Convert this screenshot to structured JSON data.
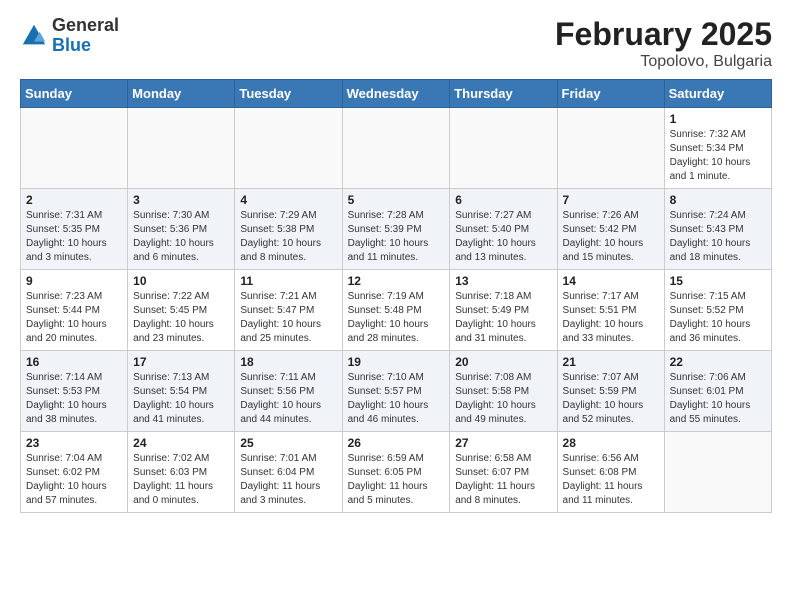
{
  "header": {
    "logo_general": "General",
    "logo_blue": "Blue",
    "month": "February 2025",
    "location": "Topolovo, Bulgaria"
  },
  "weekdays": [
    "Sunday",
    "Monday",
    "Tuesday",
    "Wednesday",
    "Thursday",
    "Friday",
    "Saturday"
  ],
  "weeks": [
    [
      {
        "day": "",
        "info": ""
      },
      {
        "day": "",
        "info": ""
      },
      {
        "day": "",
        "info": ""
      },
      {
        "day": "",
        "info": ""
      },
      {
        "day": "",
        "info": ""
      },
      {
        "day": "",
        "info": ""
      },
      {
        "day": "1",
        "info": "Sunrise: 7:32 AM\nSunset: 5:34 PM\nDaylight: 10 hours\nand 1 minute."
      }
    ],
    [
      {
        "day": "2",
        "info": "Sunrise: 7:31 AM\nSunset: 5:35 PM\nDaylight: 10 hours\nand 3 minutes."
      },
      {
        "day": "3",
        "info": "Sunrise: 7:30 AM\nSunset: 5:36 PM\nDaylight: 10 hours\nand 6 minutes."
      },
      {
        "day": "4",
        "info": "Sunrise: 7:29 AM\nSunset: 5:38 PM\nDaylight: 10 hours\nand 8 minutes."
      },
      {
        "day": "5",
        "info": "Sunrise: 7:28 AM\nSunset: 5:39 PM\nDaylight: 10 hours\nand 11 minutes."
      },
      {
        "day": "6",
        "info": "Sunrise: 7:27 AM\nSunset: 5:40 PM\nDaylight: 10 hours\nand 13 minutes."
      },
      {
        "day": "7",
        "info": "Sunrise: 7:26 AM\nSunset: 5:42 PM\nDaylight: 10 hours\nand 15 minutes."
      },
      {
        "day": "8",
        "info": "Sunrise: 7:24 AM\nSunset: 5:43 PM\nDaylight: 10 hours\nand 18 minutes."
      }
    ],
    [
      {
        "day": "9",
        "info": "Sunrise: 7:23 AM\nSunset: 5:44 PM\nDaylight: 10 hours\nand 20 minutes."
      },
      {
        "day": "10",
        "info": "Sunrise: 7:22 AM\nSunset: 5:45 PM\nDaylight: 10 hours\nand 23 minutes."
      },
      {
        "day": "11",
        "info": "Sunrise: 7:21 AM\nSunset: 5:47 PM\nDaylight: 10 hours\nand 25 minutes."
      },
      {
        "day": "12",
        "info": "Sunrise: 7:19 AM\nSunset: 5:48 PM\nDaylight: 10 hours\nand 28 minutes."
      },
      {
        "day": "13",
        "info": "Sunrise: 7:18 AM\nSunset: 5:49 PM\nDaylight: 10 hours\nand 31 minutes."
      },
      {
        "day": "14",
        "info": "Sunrise: 7:17 AM\nSunset: 5:51 PM\nDaylight: 10 hours\nand 33 minutes."
      },
      {
        "day": "15",
        "info": "Sunrise: 7:15 AM\nSunset: 5:52 PM\nDaylight: 10 hours\nand 36 minutes."
      }
    ],
    [
      {
        "day": "16",
        "info": "Sunrise: 7:14 AM\nSunset: 5:53 PM\nDaylight: 10 hours\nand 38 minutes."
      },
      {
        "day": "17",
        "info": "Sunrise: 7:13 AM\nSunset: 5:54 PM\nDaylight: 10 hours\nand 41 minutes."
      },
      {
        "day": "18",
        "info": "Sunrise: 7:11 AM\nSunset: 5:56 PM\nDaylight: 10 hours\nand 44 minutes."
      },
      {
        "day": "19",
        "info": "Sunrise: 7:10 AM\nSunset: 5:57 PM\nDaylight: 10 hours\nand 46 minutes."
      },
      {
        "day": "20",
        "info": "Sunrise: 7:08 AM\nSunset: 5:58 PM\nDaylight: 10 hours\nand 49 minutes."
      },
      {
        "day": "21",
        "info": "Sunrise: 7:07 AM\nSunset: 5:59 PM\nDaylight: 10 hours\nand 52 minutes."
      },
      {
        "day": "22",
        "info": "Sunrise: 7:06 AM\nSunset: 6:01 PM\nDaylight: 10 hours\nand 55 minutes."
      }
    ],
    [
      {
        "day": "23",
        "info": "Sunrise: 7:04 AM\nSunset: 6:02 PM\nDaylight: 10 hours\nand 57 minutes."
      },
      {
        "day": "24",
        "info": "Sunrise: 7:02 AM\nSunset: 6:03 PM\nDaylight: 11 hours\nand 0 minutes."
      },
      {
        "day": "25",
        "info": "Sunrise: 7:01 AM\nSunset: 6:04 PM\nDaylight: 11 hours\nand 3 minutes."
      },
      {
        "day": "26",
        "info": "Sunrise: 6:59 AM\nSunset: 6:05 PM\nDaylight: 11 hours\nand 5 minutes."
      },
      {
        "day": "27",
        "info": "Sunrise: 6:58 AM\nSunset: 6:07 PM\nDaylight: 11 hours\nand 8 minutes."
      },
      {
        "day": "28",
        "info": "Sunrise: 6:56 AM\nSunset: 6:08 PM\nDaylight: 11 hours\nand 11 minutes."
      },
      {
        "day": "",
        "info": ""
      }
    ]
  ]
}
